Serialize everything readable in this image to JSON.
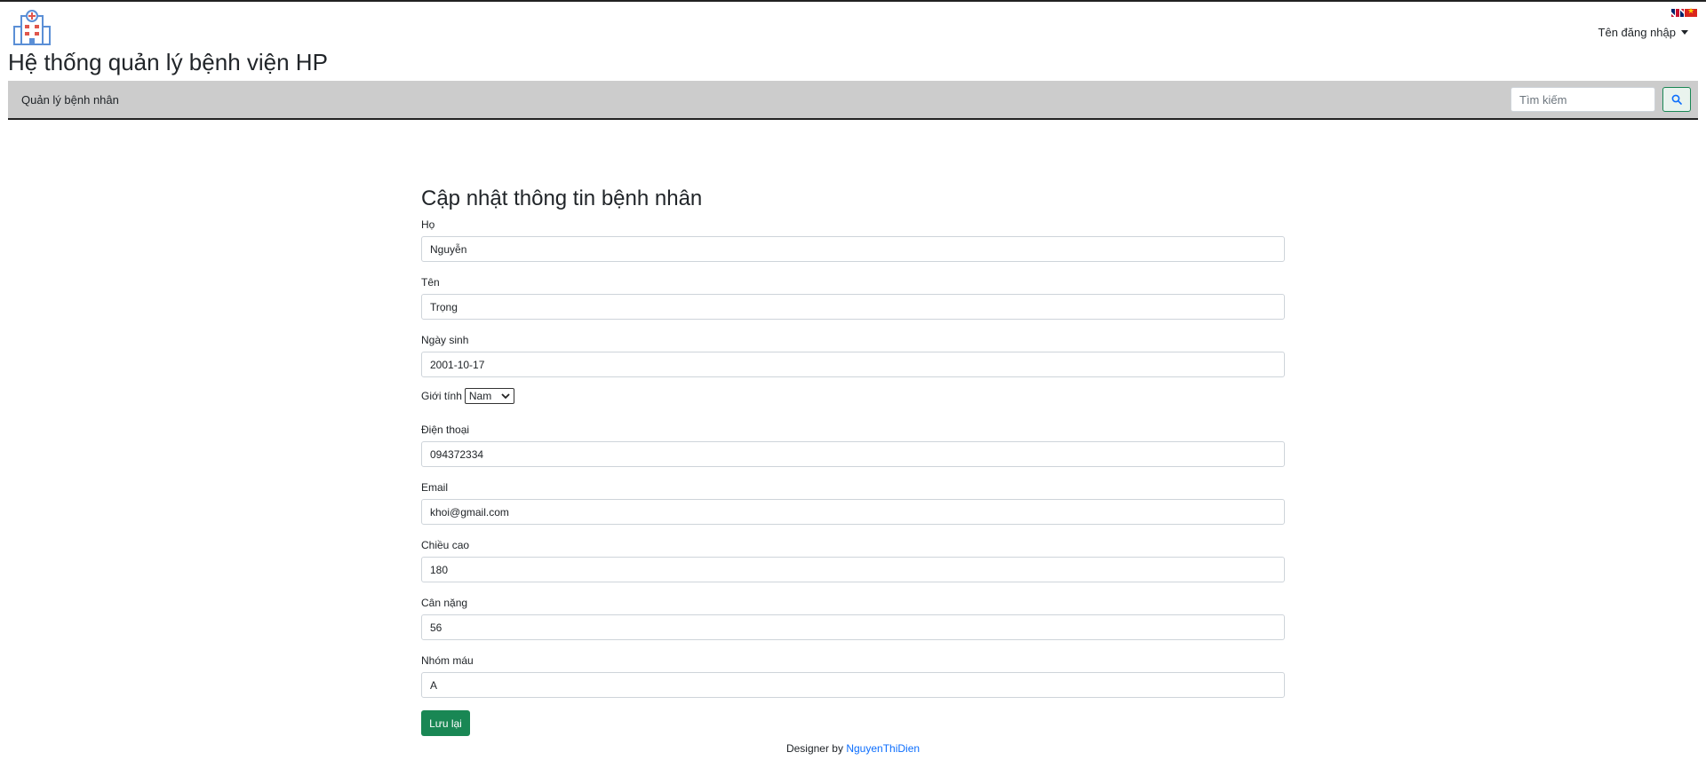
{
  "app": {
    "title": "Hệ thống quản lý bệnh viện HP",
    "logo_icon": "hospital-icon",
    "flags": [
      "flag-uk-icon",
      "flag-vn-icon"
    ],
    "user_menu_label": "Tên đăng nhập"
  },
  "navbar": {
    "link_label": "Quản lý bệnh nhân",
    "search_placeholder": "Tìm kiếm",
    "search_icon": "search-icon"
  },
  "form": {
    "title": "Cập nhật thông tin bệnh nhân",
    "last_name_label": "Họ",
    "last_name_value": "Nguyễn",
    "first_name_label": "Tên",
    "first_name_value": "Trọng",
    "dob_label": "Ngày sinh",
    "dob_value": "2001-10-17",
    "gender_label": "Giới tính",
    "gender_value": "Nam",
    "phone_label": "Điện thoại",
    "phone_value": "094372334",
    "email_label": "Email",
    "email_value": "khoi@gmail.com",
    "height_label": "Chiều cao",
    "height_value": "180",
    "weight_label": "Cân nặng",
    "weight_value": "56",
    "blood_label": "Nhóm máu",
    "blood_value": "A",
    "save_label": "Lưu lại"
  },
  "footer": {
    "prefix": "Designer by",
    "author": "NguyenThiDien"
  },
  "colors": {
    "navbar_bg": "#cccccc",
    "primary_button": "#198754",
    "link": "#0d6efd"
  }
}
